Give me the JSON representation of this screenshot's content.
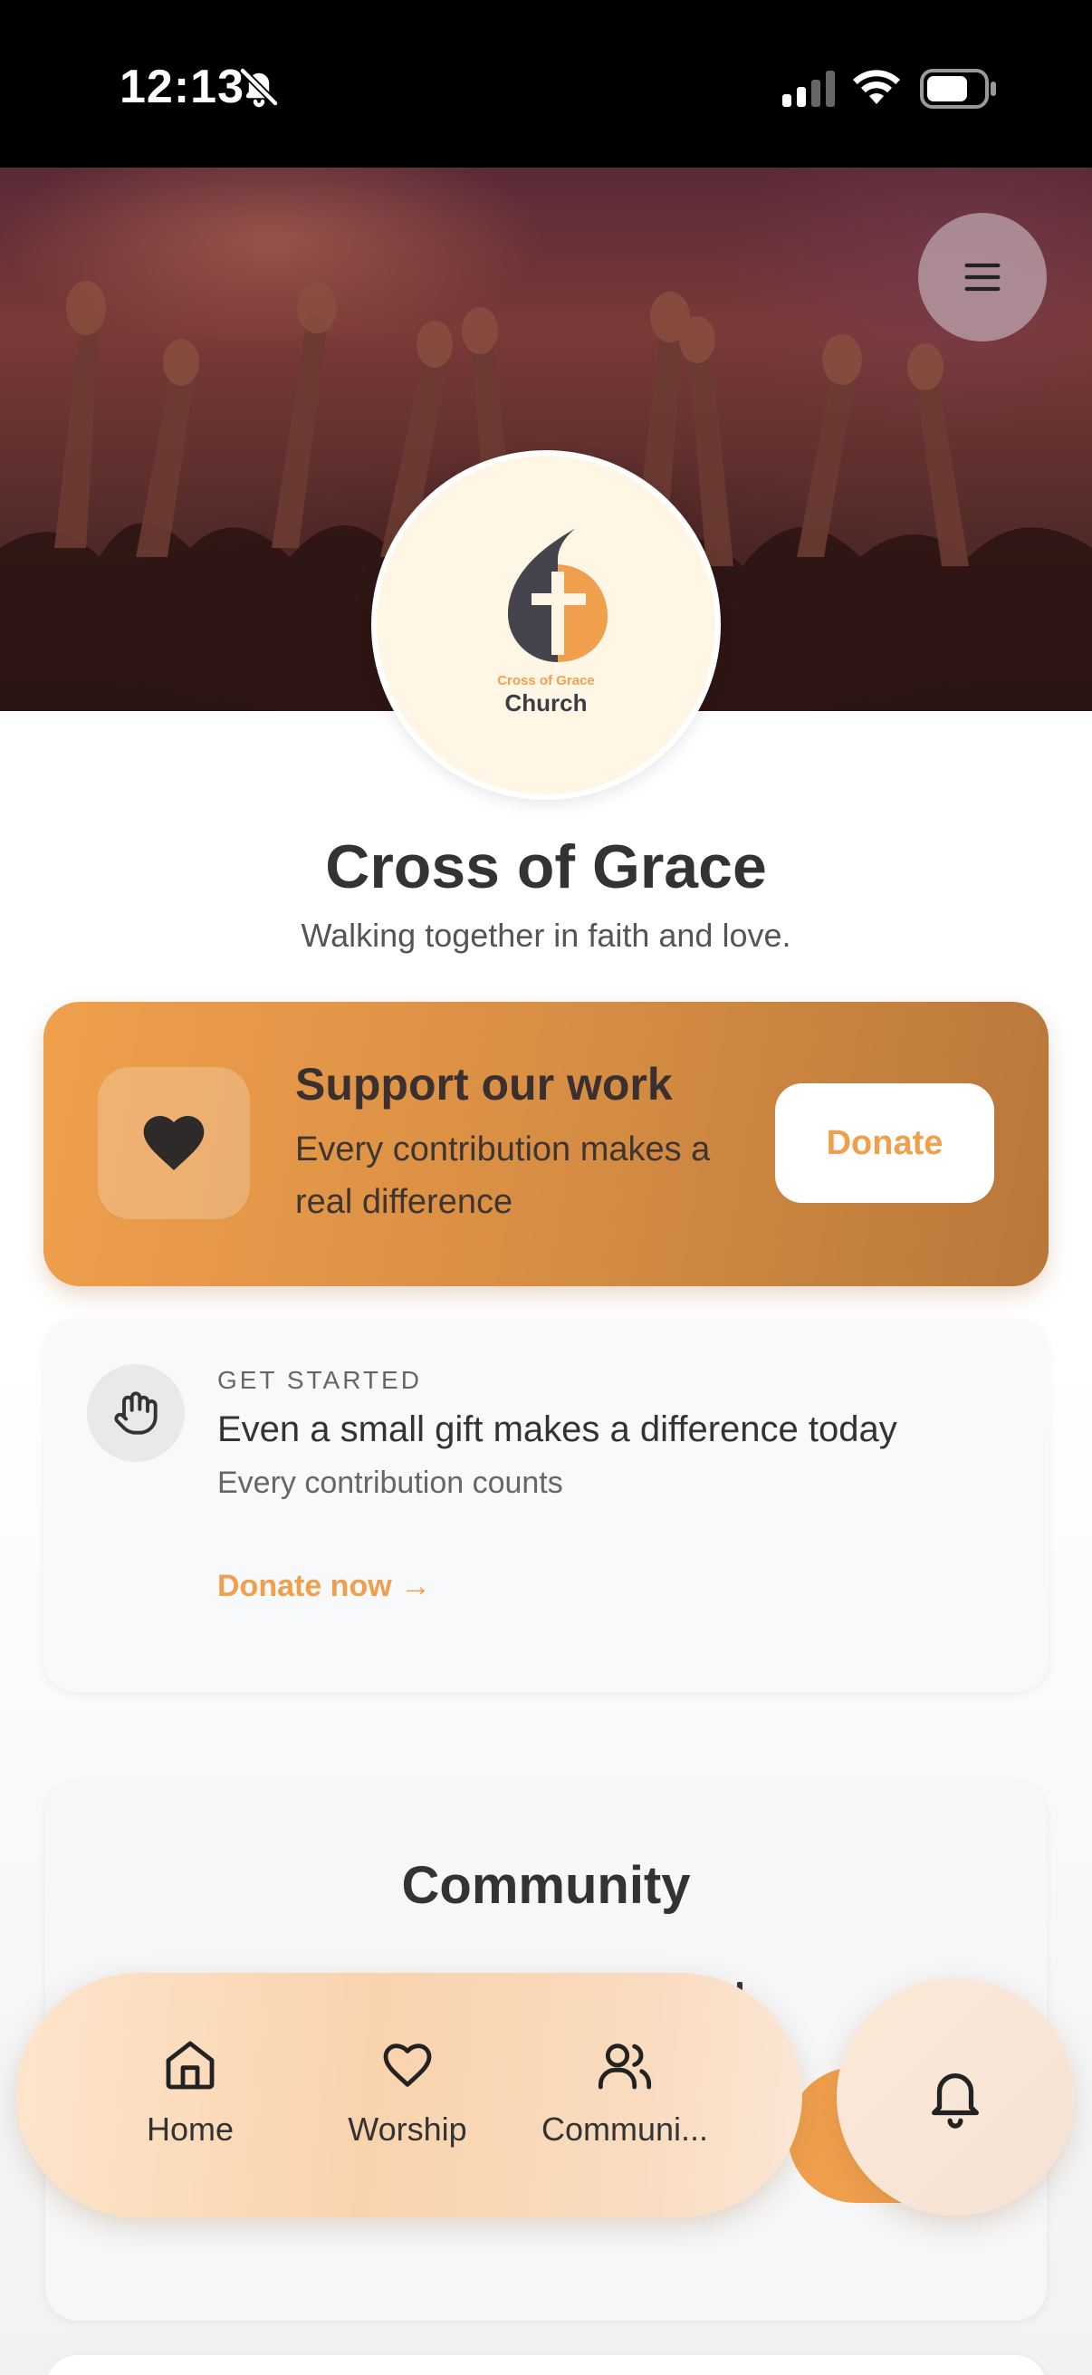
{
  "status_bar": {
    "time": "12:13",
    "icons": [
      "bell-off-icon",
      "signal-icon",
      "wifi-icon",
      "battery-icon"
    ]
  },
  "header": {
    "menu_icon": "hamburger-icon",
    "logo": {
      "small_text": "Cross of Grace",
      "big_text": "Church"
    }
  },
  "church": {
    "name": "Cross of Grace",
    "tagline": "Walking together in faith and love."
  },
  "support": {
    "title": "Support our work",
    "text": "Every contribution makes a real difference",
    "button_label": "Donate",
    "icon": "heart-icon"
  },
  "get_started": {
    "eyebrow": "GET STARTED",
    "title": "Even a small gift makes a difference today",
    "subtitle": "Every contribution counts",
    "link_label": "Donate now →",
    "icon": "hand-icon"
  },
  "community": {
    "title": "Community"
  },
  "bottom_nav": {
    "items": [
      {
        "label": "Home",
        "icon": "home-icon"
      },
      {
        "label": "Worship",
        "icon": "heart-outline-icon"
      },
      {
        "label": "Communi...",
        "icon": "users-icon"
      }
    ],
    "notifications_icon": "bell-icon"
  },
  "colors": {
    "accent": "#f0a04c",
    "status_bar": "#000000",
    "text_dark": "#333333"
  }
}
